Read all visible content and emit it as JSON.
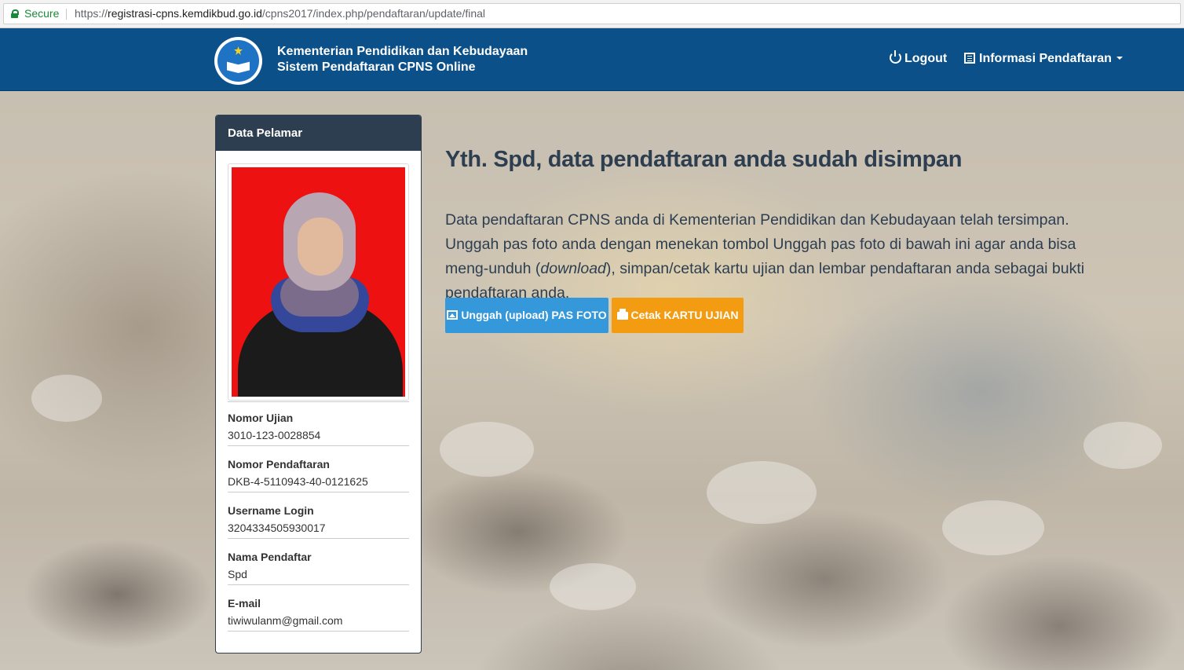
{
  "browser": {
    "secure_label": "Secure",
    "url_prefix": "https://",
    "url_domain": "registrasi-cpns.kemdikbud.go.id",
    "url_path": "/cpns2017/index.php/pendaftaran/update/final"
  },
  "header": {
    "brand_line1": "Kementerian Pendidikan dan Kebudayaan",
    "brand_line2": "Sistem Pendaftaran CPNS Online",
    "logout_label": "Logout",
    "info_label": "Informasi Pendaftaran",
    "color": "#0b5089"
  },
  "card": {
    "title": "Data Pelamar",
    "fields": [
      {
        "label": "Nomor Ujian",
        "value": "3010-123-0028854"
      },
      {
        "label": "Nomor Pendaftaran",
        "value": "DKB-4-5110943-40-0121625"
      },
      {
        "label": "Username Login",
        "value": "3204334505930017"
      },
      {
        "label": "Nama Pendaftar",
        "value": "Spd"
      },
      {
        "label": "E-mail",
        "value": "tiwiwulanm@gmail.com"
      }
    ]
  },
  "main": {
    "title": "Yth. Spd, data pendaftaran anda sudah disimpan",
    "desc_part1": "Data pendaftaran CPNS anda di Kementerian Pendidikan dan Kebudayaan telah tersimpan. Unggah pas foto anda dengan menekan tombol Unggah pas foto di bawah ini agar anda bisa meng-unduh (",
    "desc_italic": "download",
    "desc_part2": "), simpan/cetak kartu ujian dan lembar pendaftaran anda sebagai bukti pendaftaran anda.",
    "upload_button": "Unggah (upload) PAS FOTO",
    "print_button": "Cetak KARTU UJIAN",
    "upload_color": "#3498db",
    "print_color": "#f39c12"
  }
}
